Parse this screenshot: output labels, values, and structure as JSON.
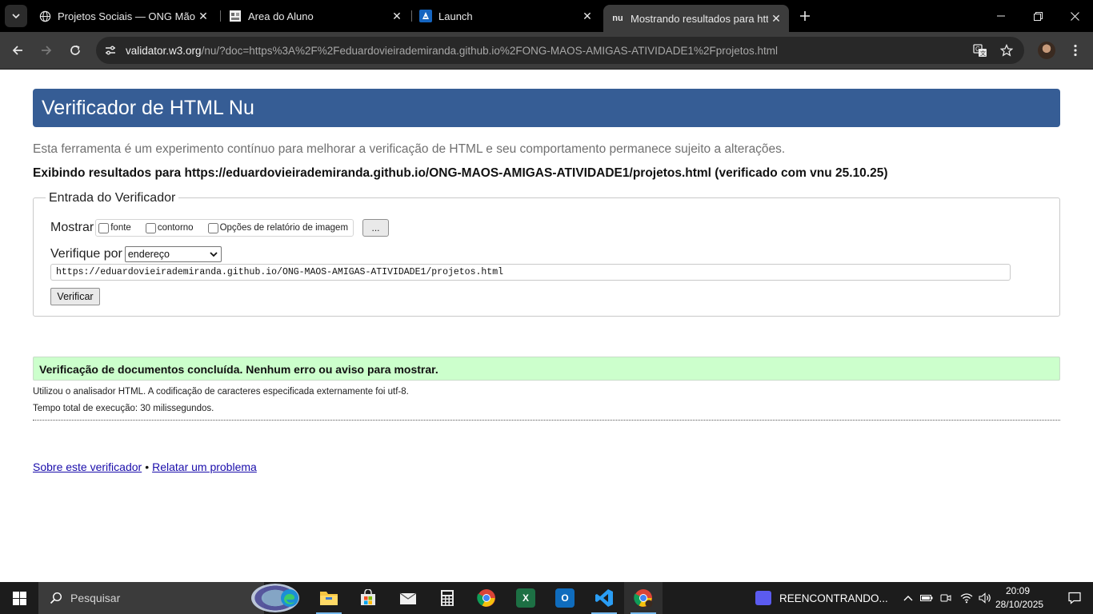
{
  "browser": {
    "tabs": [
      {
        "title": "Projetos Sociais — ONG Mãos Amigas",
        "favicon": "globe-icon"
      },
      {
        "title": "Area do Aluno",
        "favicon": "school-icon"
      },
      {
        "title": "Launch",
        "favicon": "launch-icon"
      },
      {
        "title": "Mostrando resultados para https://eduardovieirademiranda.github.io",
        "favicon": "nu",
        "active": true
      }
    ],
    "url_host": "validator.w3.org",
    "url_path": "/nu/?doc=https%3A%2F%2Feduardovieirademiranda.github.io%2FONG-MAOS-AMIGAS-ATIVIDADE1%2Fprojetos.html"
  },
  "page": {
    "banner_title": "Verificador de HTML Nu",
    "intro": "Esta ferramenta é um experimento contínuo para melhorar a verificação de HTML e seu comportamento permanece sujeito a alterações.",
    "results_for": "Exibindo resultados para https://eduardovieirademiranda.github.io/ONG-MAOS-AMIGAS-ATIVIDADE1/projetos.html (verificado com vnu 25.10.25)",
    "form": {
      "legend": "Entrada do Verificador",
      "show_label": "Mostrar",
      "options": [
        "fonte",
        "contorno",
        "Opções de relatório de imagem"
      ],
      "ellipsis_label": "...",
      "check_by_label": "Verifique por",
      "check_by_value": "endereço",
      "doc_url": "https://eduardovieirademiranda.github.io/ONG-MAOS-AMIGAS-ATIVIDADE1/projetos.html",
      "submit_label": "Verificar"
    },
    "success_message": "Verificação de documentos concluída. Nenhum erro ou aviso para mostrar.",
    "parser_info": "Utilizou o analisador HTML. A codificação de caracteres especificada externamente foi utf-8.",
    "elapsed": "Tempo total de execução: 30 milissegundos.",
    "footer": {
      "about_link": "Sobre este verificador",
      "separator": "•",
      "report_link": "Relatar um problema"
    }
  },
  "taskbar": {
    "search_placeholder": "Pesquisar",
    "media_title": "REENCONTRANDO...",
    "time": "20:09",
    "date": "28/10/2025"
  },
  "colors": {
    "banner": "#365d95",
    "success_bg": "#ccffcc",
    "link": "#1a0dab"
  }
}
